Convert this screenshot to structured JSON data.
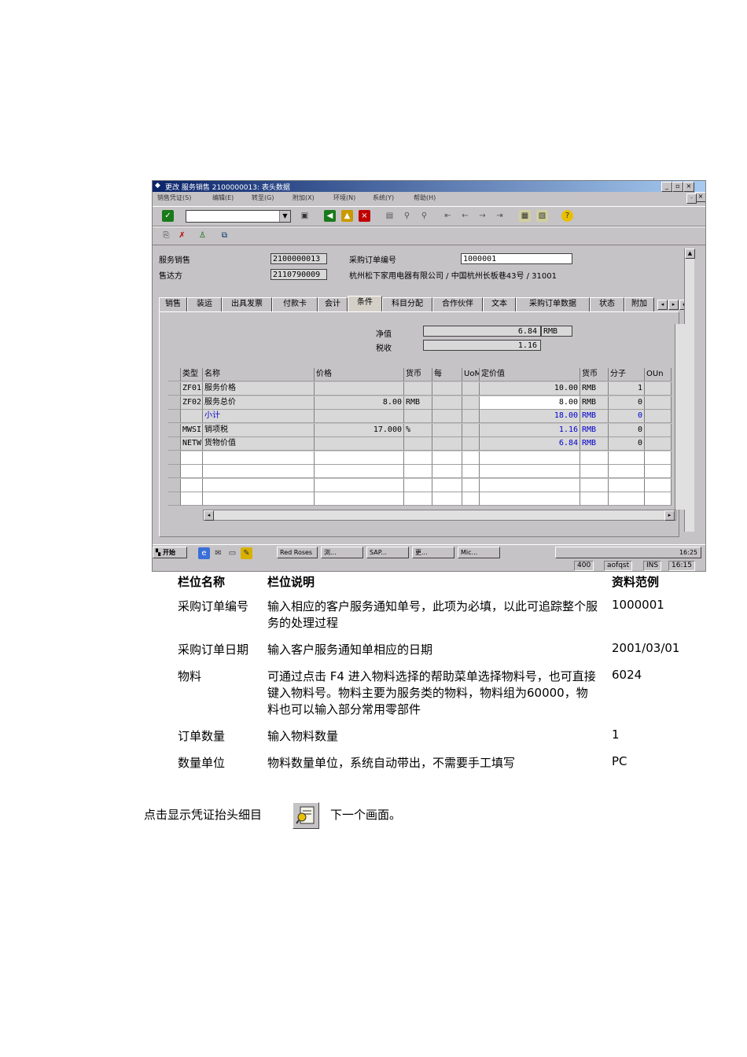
{
  "window": {
    "title": "更改 服务销售 2100000013: 表头数据",
    "menu": [
      "销售凭证(S)",
      "编辑(E)",
      "转至(G)",
      "附加(X)",
      "环境(N)",
      "系统(Y)",
      "帮助(H)"
    ]
  },
  "header": {
    "service_sales_label": "服务销售",
    "service_sales_value": "2100000013",
    "po_number_label": "采购订单编号",
    "po_number_value": "1000001",
    "ship_to_label": "售达方",
    "ship_to_value": "2110790009",
    "ship_to_address": "杭州松下家用电器有限公司 / 中国杭州长板巷43号 / 31001"
  },
  "tabs": [
    "销售",
    "装运",
    "出具发票",
    "付款卡",
    "会计",
    "条件",
    "科目分配",
    "合作伙伴",
    "文本",
    "采购订单数据",
    "状态",
    "附加"
  ],
  "conditions": {
    "net_label": "净值",
    "net_value": "6.84",
    "net_currency": "RMB",
    "tax_label": "税收",
    "tax_value": "1.16",
    "columns": [
      "类型",
      "名称",
      "价格",
      "货币",
      "每",
      "UoM",
      "定价值",
      "货币",
      "分子",
      "OUn"
    ],
    "rows": [
      {
        "type": "ZF01",
        "name": "服务价格",
        "price": "",
        "curr": "",
        "value": "10.00",
        "vcurr": "RMB",
        "num": "1",
        "blue": false
      },
      {
        "type": "ZF02",
        "name": "服务总价",
        "price": "8.00",
        "curr": "RMB",
        "value": "8.00",
        "vcurr": "RMB",
        "num": "0",
        "blue": false
      },
      {
        "type": "",
        "name": "小计",
        "price": "",
        "curr": "",
        "value": "18.00",
        "vcurr": "RMB",
        "num": "0",
        "blue": true
      },
      {
        "type": "MWSI",
        "name": "销项税",
        "price": "17.000",
        "curr": "%",
        "value": "1.16",
        "vcurr": "RMB",
        "num": "0",
        "blue": false
      },
      {
        "type": "NETW",
        "name": "货物价值",
        "price": "",
        "curr": "",
        "value": "6.84",
        "vcurr": "RMB",
        "num": "0",
        "blue": false
      }
    ]
  },
  "taskbar": {
    "start": "开始",
    "items": [
      "Red Roses",
      "浏...",
      "SAP...",
      "更...",
      "Mic..."
    ],
    "clock": "16:25"
  },
  "status": {
    "session": "400",
    "server": "aofqst",
    "mode": "INS",
    "time": "16:15"
  },
  "doc_table": {
    "headers": [
      "栏位名称",
      "栏位说明",
      "资料范例"
    ],
    "rows": [
      {
        "name": "采购订单编号",
        "desc": "输入相应的客户服务通知单号，此项为必填，以此可追踪整个服务的处理过程",
        "example": "1000001"
      },
      {
        "name": "采购订单日期",
        "desc": "输入客户服务通知单相应的日期",
        "example": "2001/03/01"
      },
      {
        "name": "物料",
        "desc": "可通过点击 F4 进入物料选择的帮助菜单选择物料号，也可直接键入物料号。物料主要为服务类的物料，物料组为60000，物料也可以输入部分常用零部件",
        "example": "6024"
      },
      {
        "name": "订单数量",
        "desc": "输入物料数量",
        "example": "1"
      },
      {
        "name": "数量单位",
        "desc": "物料数量单位，系统自动带出，不需要手工填写",
        "example": "PC"
      }
    ]
  },
  "footer": {
    "before": "点击显示凭证抬头细目",
    "after": "下一个画面。"
  }
}
